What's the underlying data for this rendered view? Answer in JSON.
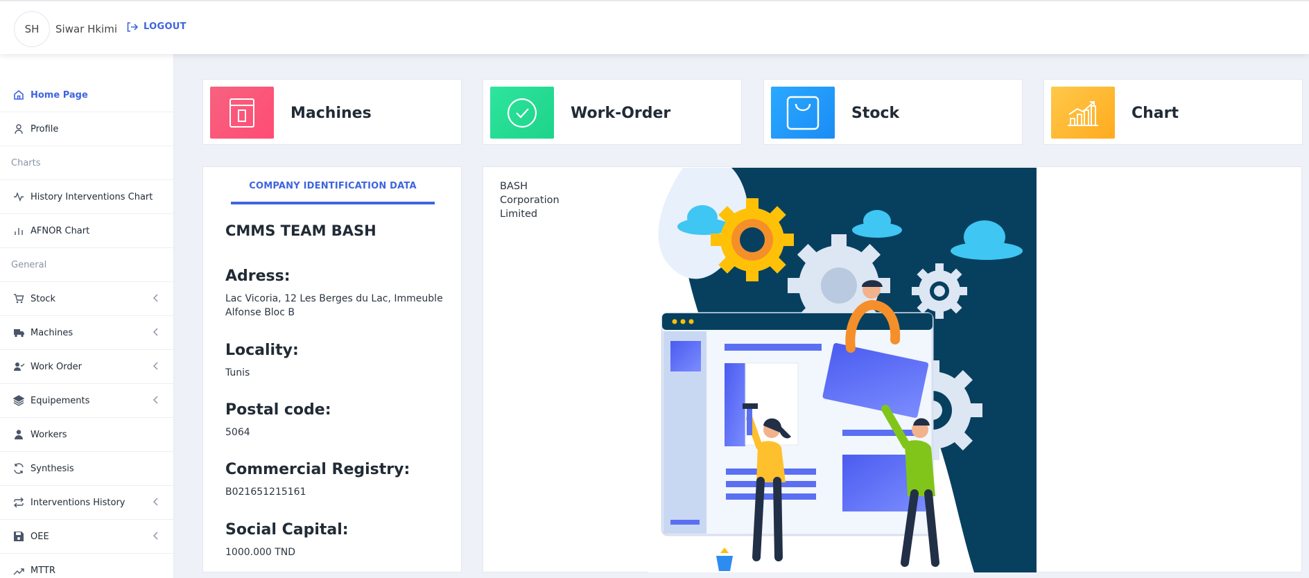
{
  "header": {
    "avatar_initials": "SH",
    "username": "Siwar Hkimi",
    "logout_label": "LOGOUT"
  },
  "sidebar": {
    "items": [
      {
        "label": "Home Page",
        "icon": "home-icon",
        "active": true
      },
      {
        "label": "Profile",
        "icon": "user-icon"
      },
      {
        "section": "Charts"
      },
      {
        "label": "History Interventions Chart",
        "icon": "activity-icon"
      },
      {
        "label": "AFNOR Chart",
        "icon": "bar-chart-icon"
      },
      {
        "section": "General"
      },
      {
        "label": "Stock",
        "icon": "cart-icon",
        "expandable": true
      },
      {
        "label": "Machines",
        "icon": "truck-icon",
        "expandable": true
      },
      {
        "label": "Work Order",
        "icon": "user-check-icon",
        "expandable": true
      },
      {
        "label": "Equipements",
        "icon": "layers-icon",
        "expandable": true
      },
      {
        "label": "Workers",
        "icon": "person-icon"
      },
      {
        "label": "Synthesis",
        "icon": "refresh-icon"
      },
      {
        "label": "Interventions History",
        "icon": "repeat-icon",
        "expandable": true
      },
      {
        "label": "OEE",
        "icon": "save-icon",
        "expandable": true
      },
      {
        "label": "MTTR",
        "icon": "trending-up-icon"
      }
    ]
  },
  "cards": [
    {
      "label": "Machines",
      "icon": "machine-icon",
      "color_from": "#f7627f",
      "color_to": "#ff4c74"
    },
    {
      "label": "Work-Order",
      "icon": "check-circle-icon",
      "color_from": "#2ee59d",
      "color_to": "#1ed38a"
    },
    {
      "label": "Stock",
      "icon": "shopping-bag-icon",
      "color_from": "#2aa9ff",
      "color_to": "#1b8cf5"
    },
    {
      "label": "Chart",
      "icon": "growth-chart-icon",
      "color_from": "#ffc84a",
      "color_to": "#ffab1f"
    }
  ],
  "company": {
    "tab_label": "COMPANY IDENTIFICATION DATA",
    "name": "CMMS TEAM BASH",
    "fields": [
      {
        "label": "Adress:",
        "value": "Lac Vicoria, 12 Les Berges du Lac, Immeuble Alfonse Bloc B"
      },
      {
        "label": "Locality:",
        "value": "Tunis"
      },
      {
        "label": "Postal code:",
        "value": "5064"
      },
      {
        "label": "Commercial Registry:",
        "value": "B021651215161"
      },
      {
        "label": "Social Capital:",
        "value": "1000.000 TND"
      }
    ]
  },
  "illustration": {
    "corp_lines": [
      "BASH",
      "Corporation",
      "Limited"
    ]
  },
  "colors": {
    "accent": "#3e64e0",
    "navy": "#07405f",
    "gear_yellow": "#ffc107",
    "cloud": "#3fc6f2",
    "window_blue": "#5b6ff2"
  }
}
